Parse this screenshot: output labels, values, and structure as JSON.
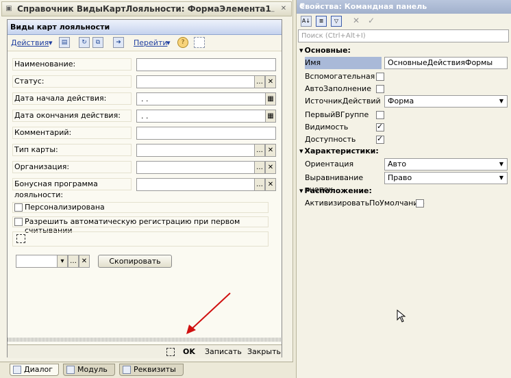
{
  "designer": {
    "title": "Справочник ВидыКартЛояльности: ФормаЭлемента1",
    "form_title": "Виды карт лояльности",
    "toolbar": {
      "actions": "Действия",
      "goto": "Перейти"
    },
    "fields": [
      {
        "label": "Наименование:",
        "value": ""
      },
      {
        "label": "Статус:",
        "value": ""
      },
      {
        "label": "Дата начала действия:",
        "value": " .  ."
      },
      {
        "label": "Дата окончания действия:",
        "value": " .  ."
      },
      {
        "label": "Комментарий:",
        "value": ""
      },
      {
        "label": "Тип карты:",
        "value": ""
      },
      {
        "label": "Организация:",
        "value": ""
      },
      {
        "label": "Бонусная программа лояльности:",
        "value": ""
      }
    ],
    "checkboxes": {
      "personalized": "Персонализирована",
      "auto_register": "Разрешить автоматическую регистрацию при первом считывании"
    },
    "copy_button": "Скопировать",
    "bottom": {
      "ok": "OK",
      "save": "Записать",
      "close": "Закрыть"
    },
    "tabs": [
      "Диалог",
      "Модуль",
      "Реквизиты"
    ]
  },
  "props": {
    "title": "Свойства: Командная панель",
    "search_placeholder": "Поиск (Ctrl+Alt+I)",
    "sections": {
      "main": "Основные:",
      "characteristics": "Характеристики:",
      "location": "Расположение:"
    },
    "main": {
      "name_label": "Имя",
      "name_value": "ОсновныеДействияФормы",
      "aux_label": "Вспомогательная",
      "autofill_label": "АвтоЗаполнение",
      "source_label": "ИсточникДействий",
      "source_value": "Форма",
      "first_label": "ПервыйВГруппе",
      "visible_label": "Видимость",
      "enabled_label": "Доступность"
    },
    "chars": {
      "orientation_label": "Ориентация",
      "orientation_value": "Авто",
      "align_label": "Выравнивание кнопок",
      "align_value": "Право"
    },
    "loc": {
      "activate_label": "АктивизироватьПоУмолчанию"
    }
  }
}
